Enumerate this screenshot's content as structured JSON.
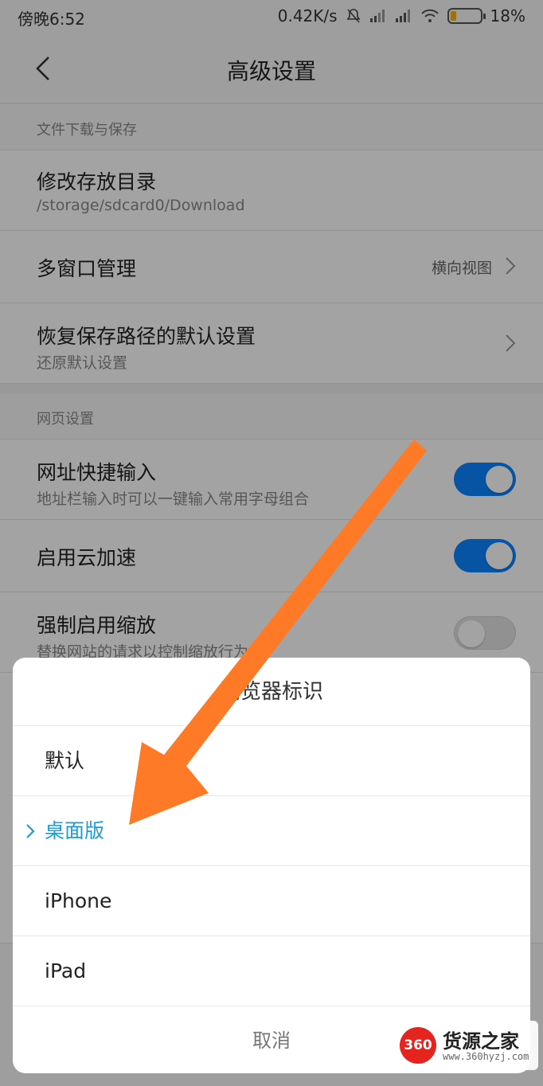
{
  "status_bar": {
    "time": "傍晚6:52",
    "speed": "0.42K/s",
    "battery": "18%",
    "battery_level": 0.18
  },
  "header": {
    "title": "高级设置"
  },
  "sections": {
    "download": {
      "label": "文件下载与保存",
      "items": [
        {
          "title": "修改存放目录",
          "subtitle": "/storage/sdcard0/Download"
        },
        {
          "title": "多窗口管理",
          "value": "横向视图"
        },
        {
          "title": "恢复保存路径的默认设置",
          "subtitle": "还原默认设置"
        }
      ]
    },
    "web": {
      "label": "网页设置",
      "items": [
        {
          "title": "网址快捷输入",
          "subtitle": "地址栏输入时可以一键输入常用字母组合",
          "toggle": true
        },
        {
          "title": "启用云加速",
          "toggle": true
        },
        {
          "title": "强制启用缩放",
          "subtitle": "替换网站的请求以控制缩放行为",
          "toggle": false
        }
      ]
    }
  },
  "dialog": {
    "title": "浏览器标识",
    "options": [
      "默认",
      "桌面版",
      "iPhone",
      "iPad"
    ],
    "selected_index": 1,
    "cancel_label": "取消"
  },
  "colors": {
    "accent": "#1e9ad6",
    "toggle_on": "#0a84ff",
    "arrow": "#ff7a26"
  },
  "watermark": {
    "badge": "360",
    "name": "货源之家",
    "url": "www.360hyzj.com"
  }
}
